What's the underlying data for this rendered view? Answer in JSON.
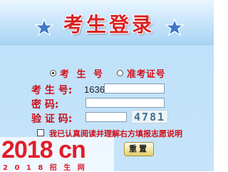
{
  "header": {
    "title": "考生登录"
  },
  "login_type": {
    "options": [
      {
        "label": "考 生 号",
        "checked": true
      },
      {
        "label": "准考证号",
        "checked": false
      }
    ]
  },
  "form": {
    "candidate_label": "考 生 号:",
    "candidate_value": "1636",
    "password_label": "密    码:",
    "captcha_label": "验 证 码:",
    "captcha_code": "4781"
  },
  "agreement": {
    "text": "我已认真阅读并理解右方填报志愿说明",
    "checked": false
  },
  "buttons": {
    "reset_label": "重置"
  },
  "watermark": {
    "main_text": "2018 cn",
    "sub_text": "2 0 1 8 招 生 网"
  },
  "colors": {
    "title": "#d92222",
    "label": "#c8101a",
    "logo": "#e11d2b",
    "panel": "#c6e4f9"
  },
  "icons": {
    "stars": [
      "star-icon",
      "star-icon"
    ]
  }
}
